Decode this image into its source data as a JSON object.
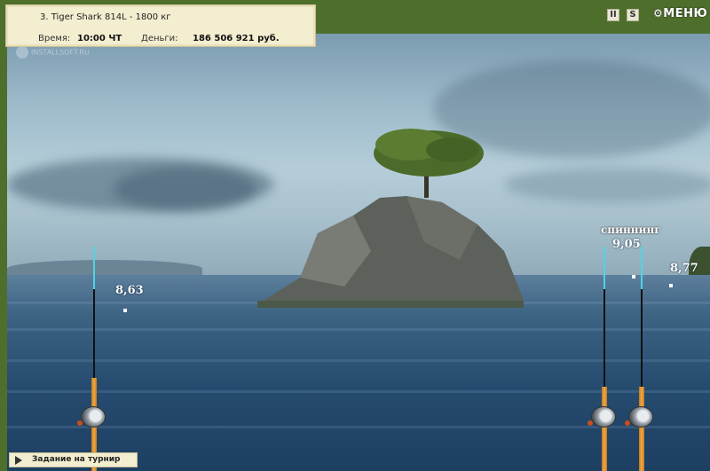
{
  "info": {
    "title": "3. Tiger Shark 814L - 1800 кг",
    "time_label": "Время:",
    "time_value": "10:00 ЧТ",
    "money_label": "Деньги:",
    "money_value": "186 506 921 руб."
  },
  "watermark": "INSTALLSOFT.RU",
  "controls": {
    "pause_label": "II",
    "sound_label": "S",
    "menu_label": "МЕНЮ"
  },
  "rods": [
    {
      "distance": "8,63",
      "label": ""
    },
    {
      "distance": "9,05",
      "label": "спиннинг"
    },
    {
      "distance": "8,77",
      "label": ""
    }
  ],
  "task_button": "Задание на турнир",
  "colors": {
    "frame": "#4e6f2b",
    "panel": "#f3eed0",
    "rod_tip": "#4fd4e6",
    "rod_butt": "#f2a844"
  }
}
